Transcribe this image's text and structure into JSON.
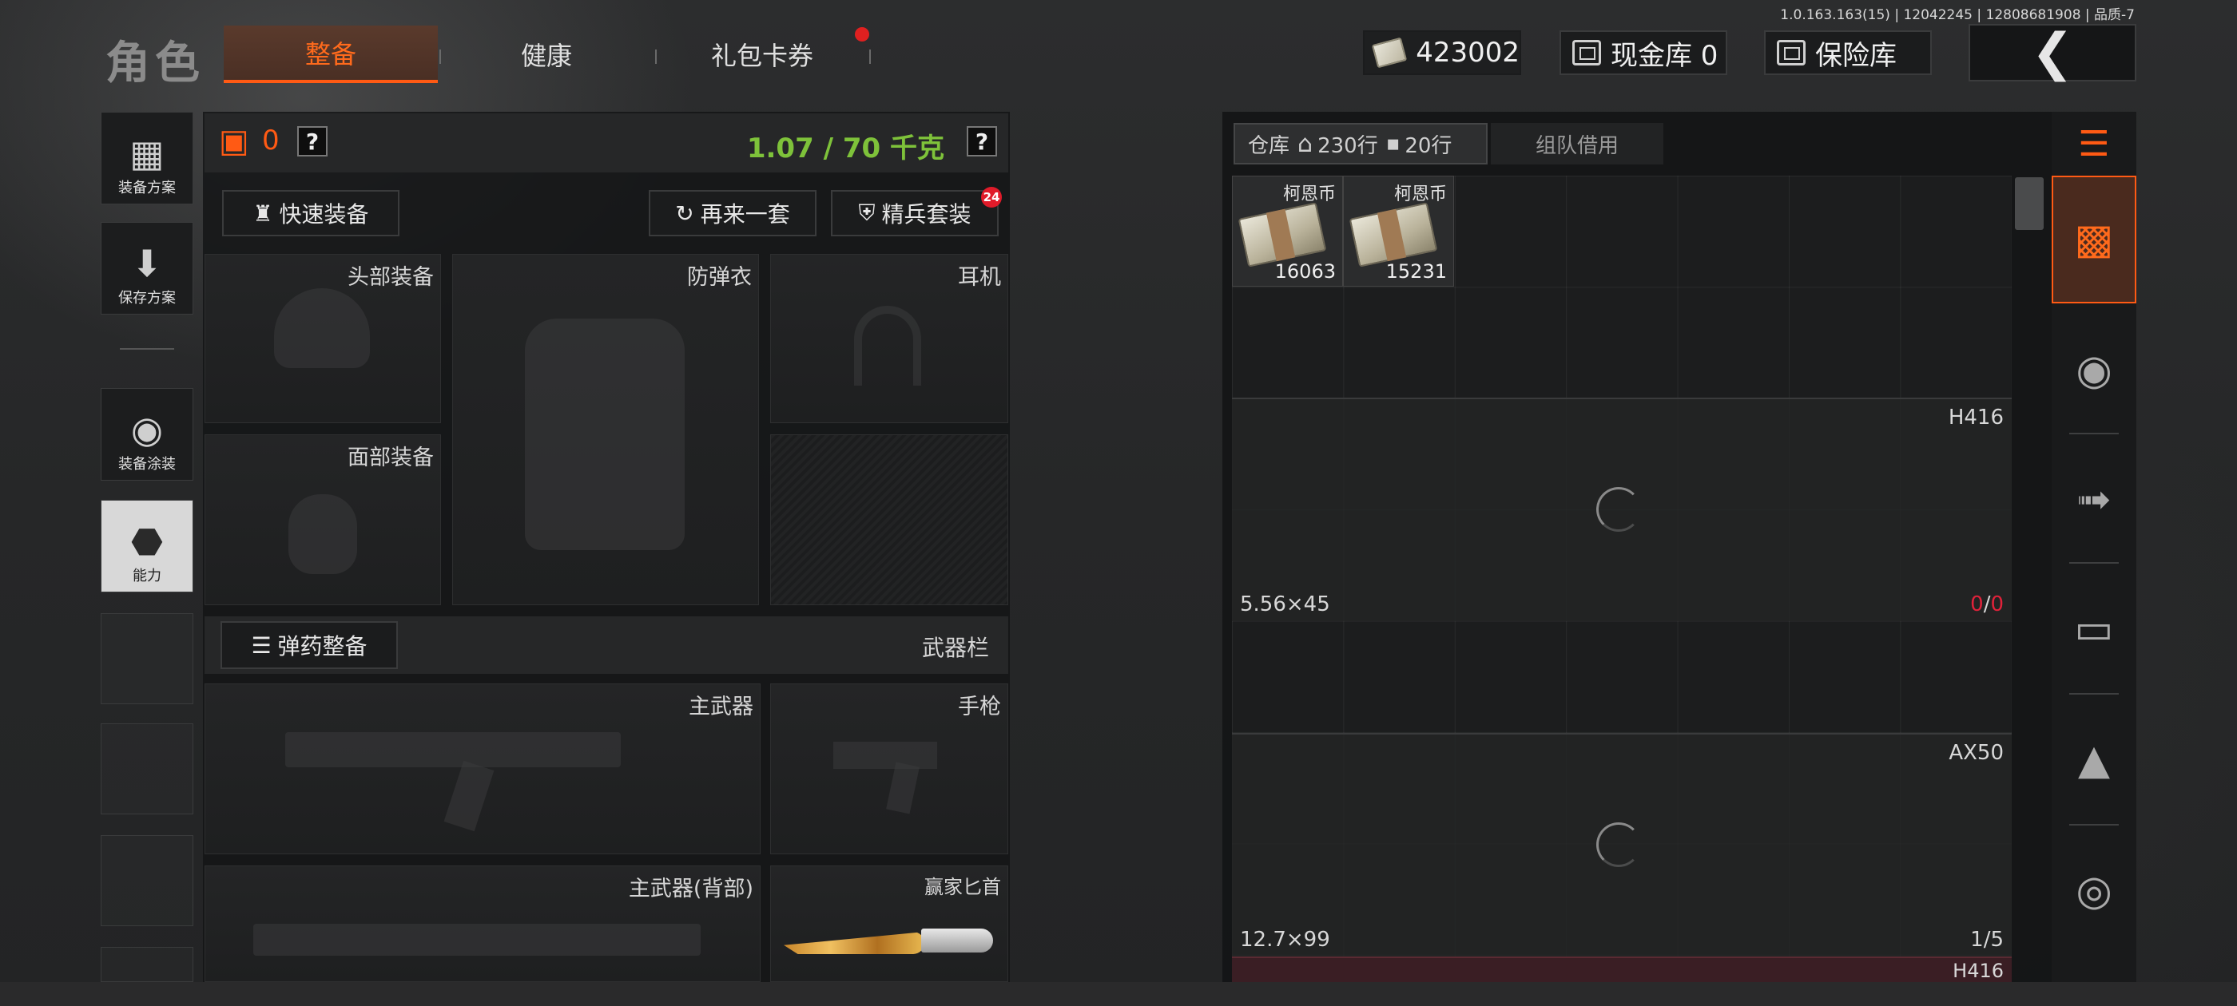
{
  "version": "1.0.163.163(15) | 12042245 | 12808681908 | 品质-7",
  "header": {
    "role_title": "角色",
    "tabs": [
      {
        "label": "整备",
        "active": true
      },
      {
        "label": "健康",
        "active": false
      },
      {
        "label": "礼包卡券",
        "active": false,
        "has_notification": true
      }
    ]
  },
  "currency": {
    "hafcoin": "423002",
    "cash_vault_label": "现金库 0",
    "safe_label": "保险库"
  },
  "side_nav": [
    {
      "label": "装备方案",
      "icon": "backpack-icon"
    },
    {
      "label": "保存方案",
      "icon": "download-icon"
    },
    {
      "label": "装备涂装",
      "icon": "helmet-paint-icon"
    },
    {
      "label": "能力",
      "icon": "ability-icon"
    }
  ],
  "equipment": {
    "armor_value": "0",
    "weight": "1.07 / 70 千克",
    "help": "?",
    "quick_equip": "快速装备",
    "random_set": "再来一套",
    "elite_set": "精兵套装",
    "elite_badge": "24",
    "slots": {
      "head": "头部装备",
      "vest": "防弹衣",
      "headset": "耳机",
      "face": "面部装备"
    },
    "ammo_equip": "弹药整备",
    "weapon_bar": "武器栏",
    "weapons": {
      "primary": "主武器",
      "pistol": "手枪",
      "primary_back": "主武器(背部)",
      "knife": "赢家匕首"
    }
  },
  "warehouse": {
    "tab_label": "仓库",
    "rows_home": "230行",
    "rows_case": "20行",
    "team_borrow": "组队借用",
    "money": [
      {
        "label": "柯恩币",
        "value": "16063"
      },
      {
        "label": "柯恩币",
        "value": "15231"
      }
    ],
    "weapon_slots": [
      {
        "name": "H416",
        "ammo": "5.56×45",
        "count_left": "0",
        "count_sep": "/",
        "count_right": "0",
        "highlight": true
      },
      {
        "name": "AX50",
        "ammo": "12.7×99",
        "count_left": "1",
        "count_sep": "/",
        "count_right": "5",
        "highlight": false
      },
      {
        "name": "H416",
        "ammo": "",
        "count_left": "",
        "count_sep": "",
        "count_right": "",
        "highlight": false
      }
    ]
  },
  "right_categories": [
    {
      "icon": "sort-icon"
    },
    {
      "icon": "warehouse-icon"
    },
    {
      "icon": "helmet-icon"
    },
    {
      "icon": "rifle-icon"
    },
    {
      "icon": "magazine-icon"
    },
    {
      "icon": "bullet-icon"
    },
    {
      "icon": "scope-icon"
    }
  ],
  "colors": {
    "accent": "#ff5a14",
    "weight_green": "#7ec23a",
    "alert_red": "#e0223a"
  }
}
